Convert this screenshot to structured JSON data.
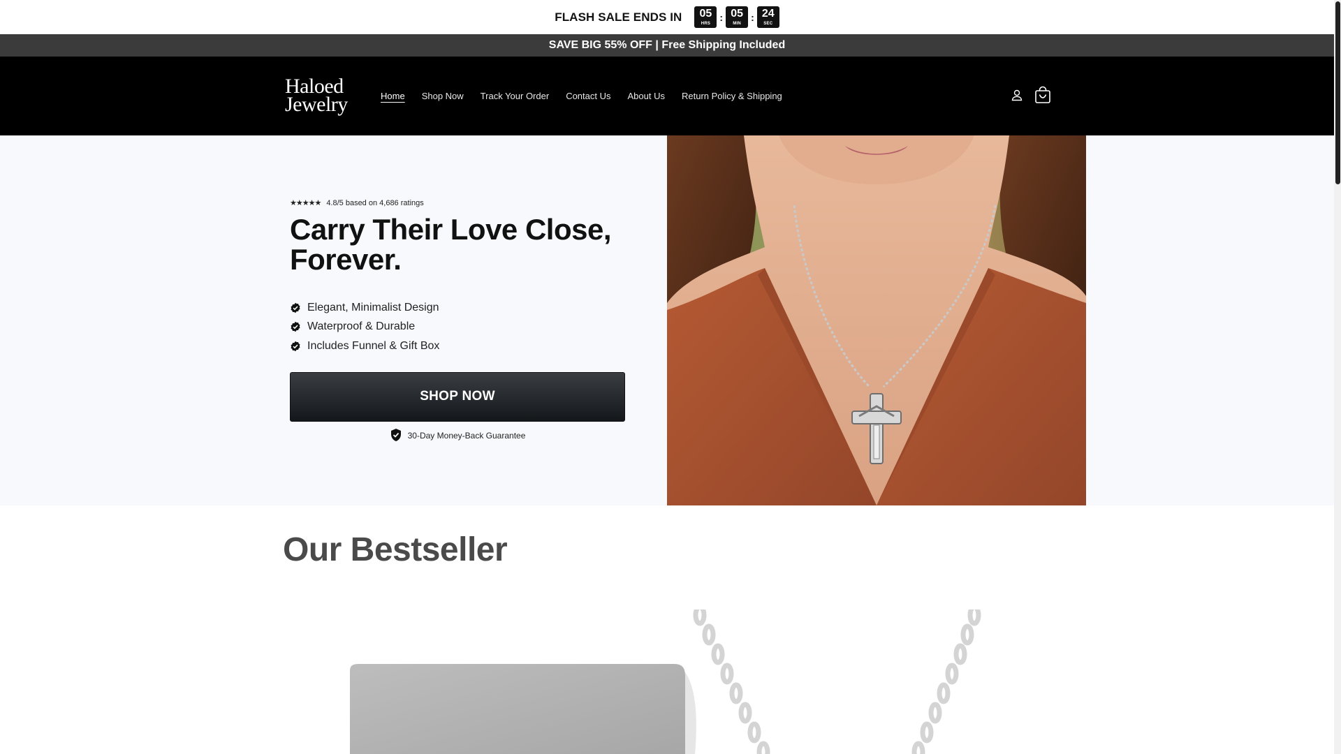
{
  "flash_sale": {
    "title": "FLASH SALE ENDS IN",
    "countdown": [
      {
        "value": "05",
        "unit": "HRS"
      },
      {
        "value": "05",
        "unit": "MIN"
      },
      {
        "value": "24",
        "unit": "SEC"
      }
    ],
    "separator": ":"
  },
  "announcement": "SAVE BIG 55% OFF | Free Shipping Included",
  "header": {
    "logo_line1": "Haloed",
    "logo_line2": "Jewelry",
    "nav": [
      "Home",
      "Shop Now",
      "Track Your Order",
      "Contact Us",
      "About Us",
      "Return Policy & Shipping"
    ],
    "active_nav": "Home",
    "icons": [
      "account-icon",
      "cart-icon"
    ]
  },
  "hero": {
    "stars": "★★★★★",
    "rating_text": "4.8/5 based on 4,686 ratings",
    "title": "Carry Their Love Close, Forever.",
    "features": [
      "Elegant, Minimalist Design",
      "Waterproof & Durable",
      "Includes Funnel & Gift Box"
    ],
    "cta": "SHOP NOW",
    "guarantee": "30-Day Money-Back Guarantee"
  },
  "bestseller": {
    "title": "Our Bestseller"
  },
  "colors": {
    "header_bg": "#000000",
    "announcement_bg": "#3b3b3b",
    "hero_bg": "#f7f9fc",
    "sweater": "#a8502d"
  }
}
